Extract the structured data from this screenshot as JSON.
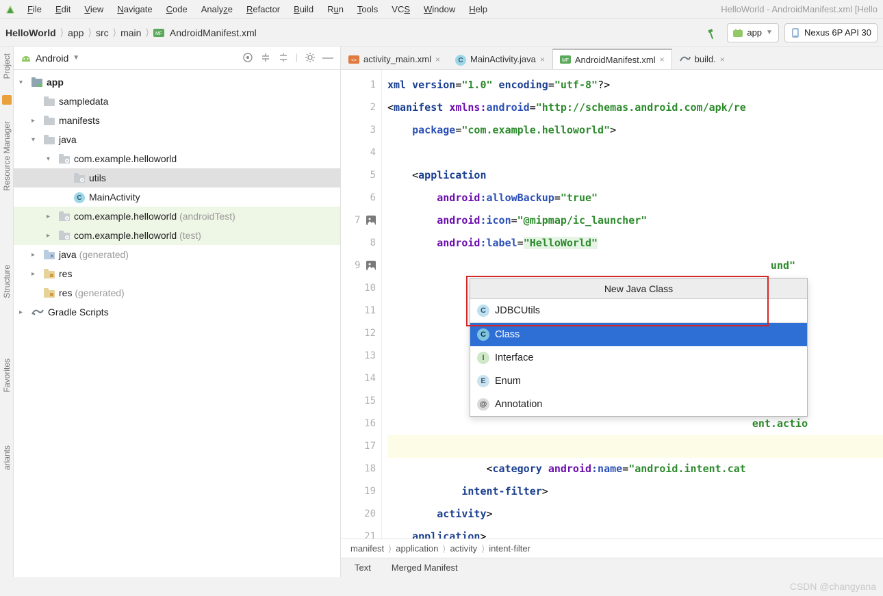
{
  "menubar": {
    "items": [
      "File",
      "Edit",
      "View",
      "Navigate",
      "Code",
      "Analyze",
      "Refactor",
      "Build",
      "Run",
      "Tools",
      "VCS",
      "Window",
      "Help"
    ],
    "window_title": "HelloWorld - AndroidManifest.xml [Hello"
  },
  "breadcrumb": {
    "items": [
      "HelloWorld",
      "app",
      "src",
      "main",
      "AndroidManifest.xml"
    ]
  },
  "toolbar": {
    "run_config": "app",
    "device": "Nexus 6P API 30"
  },
  "project_panel": {
    "view_label": "Android",
    "tree": [
      {
        "d": 0,
        "arrow": "v",
        "icon": "module",
        "label": "app",
        "bold": true
      },
      {
        "d": 1,
        "arrow": "",
        "icon": "folder",
        "label": "sampledata"
      },
      {
        "d": 1,
        "arrow": ">",
        "icon": "folder",
        "label": "manifests"
      },
      {
        "d": 1,
        "arrow": "v",
        "icon": "folder",
        "label": "java"
      },
      {
        "d": 2,
        "arrow": "v",
        "icon": "pkg",
        "label": "com.example.helloworld"
      },
      {
        "d": 3,
        "arrow": "",
        "icon": "pkg",
        "label": "utils",
        "selected": true
      },
      {
        "d": 3,
        "arrow": "",
        "icon": "class",
        "label": "MainActivity"
      },
      {
        "d": 2,
        "arrow": ">",
        "icon": "pkg",
        "label": "com.example.helloworld",
        "suffix": " (androidTest)",
        "testbg": true
      },
      {
        "d": 2,
        "arrow": ">",
        "icon": "pkg",
        "label": "com.example.helloworld",
        "suffix": " (test)",
        "testbg": true
      },
      {
        "d": 1,
        "arrow": ">",
        "icon": "genfolder",
        "label": "java",
        "suffix": " (generated)"
      },
      {
        "d": 1,
        "arrow": ">",
        "icon": "resfolder",
        "label": "res"
      },
      {
        "d": 1,
        "arrow": "",
        "icon": "resfolder",
        "label": "res",
        "suffix": " (generated)"
      },
      {
        "d": 0,
        "arrow": ">",
        "icon": "gradle",
        "label": "Gradle Scripts"
      }
    ]
  },
  "side_tabs": {
    "items": [
      "Project",
      "Resource Manager",
      "Structure",
      "Favorites",
      "ariants"
    ]
  },
  "editor_tabs": {
    "items": [
      {
        "label": "activity_main.xml",
        "icon": "xml"
      },
      {
        "label": "MainActivity.java",
        "icon": "class"
      },
      {
        "label": "AndroidManifest.xml",
        "icon": "mf",
        "active": true
      },
      {
        "label": "build.",
        "icon": "gradle"
      }
    ]
  },
  "gutter": {
    "lines": [
      "1",
      "2",
      "3",
      "4",
      "5",
      "6",
      "7",
      "8",
      "9",
      "10",
      "11",
      "12",
      "13",
      "14",
      "15",
      "16",
      "17",
      "18",
      "19",
      "20",
      "21"
    ],
    "image_icons_at": [
      7,
      9
    ]
  },
  "code": {
    "l1": {
      "a": "<?",
      "b": "xml version",
      "c": "=",
      "d": "\"1.0\"",
      "e": " encoding",
      "f": "=",
      "g": "\"utf-8\"",
      "h": "?>"
    },
    "l2": {
      "a": "<",
      "b": "manifest ",
      "c": "xmlns:",
      "d": "android",
      "e": "=",
      "f": "\"http://schemas.android.com/apk/re"
    },
    "l3": {
      "a": "package",
      "b": "=",
      "c": "\"com.example.helloworld\"",
      "d": ">"
    },
    "l5": {
      "a": "<",
      "b": "application"
    },
    "l6": {
      "a": "android",
      "b": ":allowBackup",
      "c": "=",
      "d": "\"true\""
    },
    "l7": {
      "a": "android",
      "b": ":icon",
      "c": "=",
      "d": "\"@mipmap/ic_launcher\""
    },
    "l8": {
      "a": "android",
      "b": ":label",
      "c": "=",
      "d": "\"HelloWorld\""
    },
    "l9": {
      "a": "und\""
    },
    "l16": {
      "a": "ent.actio"
    },
    "l18": {
      "a": "<",
      "b": "category ",
      "c": "android",
      "d": ":name",
      "e": "=",
      "f": "\"android.intent.cat"
    },
    "l19": {
      "a": "</",
      "b": "intent-filter",
      "c": ">"
    },
    "l20": {
      "a": "</",
      "b": "activity",
      "c": ">"
    },
    "l21": {
      "a": "</",
      "b": "application",
      "c": ">"
    }
  },
  "editor_breadcrumb": {
    "items": [
      "manifest",
      "application",
      "activity",
      "intent-filter"
    ]
  },
  "bottom_tabs": {
    "items": [
      "Text",
      "Merged Manifest"
    ]
  },
  "popup": {
    "title": "New Java Class",
    "input_value": "JDBCUtils",
    "options": [
      {
        "icon": "C",
        "label": "Class",
        "selected": true
      },
      {
        "icon": "I",
        "label": "Interface"
      },
      {
        "icon": "E",
        "label": "Enum"
      },
      {
        "icon": "@",
        "label": "Annotation"
      }
    ]
  },
  "watermark": "CSDN @changyana"
}
